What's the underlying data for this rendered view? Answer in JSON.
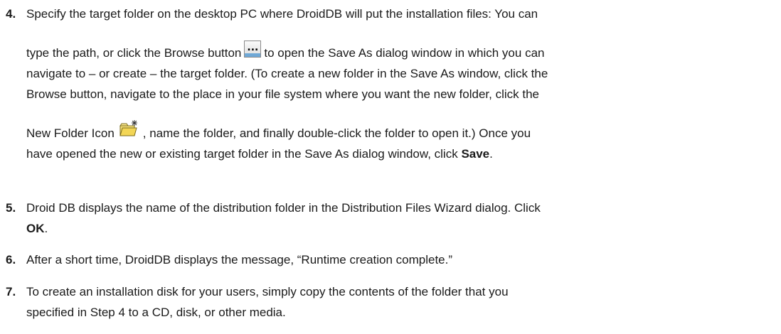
{
  "steps": [
    {
      "number": "4.",
      "line1": "Specify the target folder on the desktop PC where DroidDB will put the installation files: You can",
      "line2_before": "type the path, or click the Browse button",
      "browse_button_label": "...",
      "line2_after": "to open the Save As dialog window in which you can",
      "line3": "navigate to – or create – the target folder. (To create a new folder in the Save As window, click the",
      "line4": "Browse button, navigate to the place in your file system where you want the new folder, click the",
      "line5_before": "New Folder Icon",
      "new_folder_icon": "new-folder-icon",
      "line5_after": ", name the folder, and finally double-click the folder to open it.) Once you",
      "line6_before": "have opened the new or existing target folder in the Save As dialog window, click ",
      "line6_bold": "Save",
      "line6_after": "."
    },
    {
      "number": "5.",
      "line1": "Droid DB displays the name of the distribution folder in the Distribution Files Wizard dialog. Click",
      "line2_bold": "OK",
      "line2_after": "."
    },
    {
      "number": "6.",
      "line1": "After a short time, DroidDB displays the message, “Runtime creation complete.”"
    },
    {
      "number": "7.",
      "line1": "To create an installation disk for your users, simply copy the contents of the folder that you",
      "line2": "specified in Step 4 to a CD, disk, or other media."
    }
  ],
  "colors": {
    "text": "#1a1a1a",
    "button_face": "#dcdcdc",
    "button_accent": "#6fa8d6",
    "folder_yellow": "#f7e27a"
  }
}
